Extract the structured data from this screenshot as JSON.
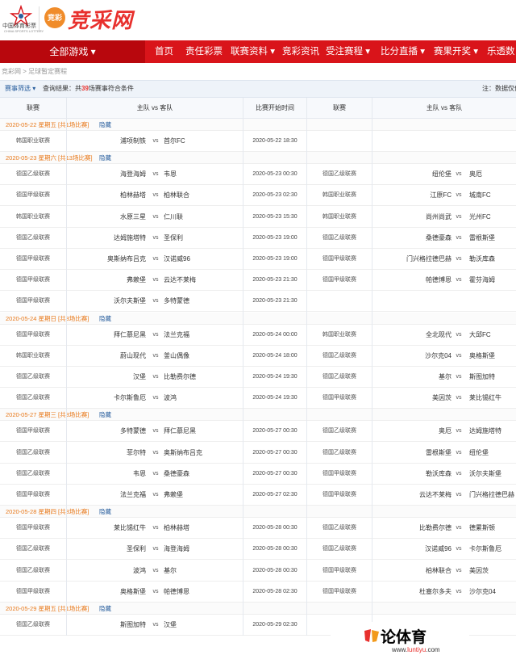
{
  "header": {
    "logo_cn": "中国体育彩票",
    "logo_en": "CHINA SPORTS LOTTERY",
    "badge": "竞彩",
    "site_name": "竞采网"
  },
  "nav": {
    "all_games": "全部游戏 ▾",
    "items": [
      "首页",
      "责任彩票",
      "联赛资料 ▾",
      "竞彩资讯",
      "受注赛程 ▾",
      "比分直播 ▾",
      "赛果开奖 ▾",
      "乐透数"
    ]
  },
  "breadcrumb": "竞彩网 > 足球暂定赛程",
  "filter": {
    "filter_label": "赛事筛选 ▾",
    "result_prefix": "查询结果：共",
    "result_count": "39",
    "result_suffix": "场赛事符合条件",
    "note": "注：数据仅供"
  },
  "table_header": {
    "league": "联赛",
    "teams": "主队 vs 客队",
    "time": "比赛开始时间",
    "league2": "联赛",
    "teams2": "主队 vs 客队"
  },
  "vs": "vs",
  "hide_label": "隐藏",
  "days": [
    {
      "date": "2020-05-22 星期五 [共1场比赛]",
      "rows": [
        {
          "l1": "韩国职业联赛",
          "h1": "浦项制铁",
          "a1": "首尔FC",
          "t1": "2020-05-22 18:30"
        }
      ]
    },
    {
      "date": "2020-05-23 星期六 [共13场比赛]",
      "rows": [
        {
          "l1": "德国乙级联赛",
          "h1": "海登海姆",
          "a1": "韦恩",
          "t1": "2020-05-23 00:30",
          "l2": "德国乙级联赛",
          "h2": "纽伦堡",
          "a2": "奥厄"
        },
        {
          "l1": "德国甲级联赛",
          "h1": "柏林赫塔",
          "a1": "柏林联合",
          "t1": "2020-05-23 02:30",
          "l2": "韩国职业联赛",
          "h2": "江原FC",
          "a2": "城南FC"
        },
        {
          "l1": "韩国职业联赛",
          "h1": "水原三星",
          "a1": "仁川联",
          "t1": "2020-05-23 15:30",
          "l2": "韩国职业联赛",
          "h2": "尚州尚武",
          "a2": "光州FC"
        },
        {
          "l1": "德国乙级联赛",
          "h1": "达姆施塔特",
          "a1": "圣保利",
          "t1": "2020-05-23 19:00",
          "l2": "德国乙级联赛",
          "h2": "桑德豪森",
          "a2": "雷根斯堡"
        },
        {
          "l1": "德国甲级联赛",
          "h1": "奥斯纳布吕克",
          "a1": "汉诺威96",
          "t1": "2020-05-23 19:00",
          "l2": "德国甲级联赛",
          "h2": "门兴格拉德巴赫",
          "a2": "勒沃库森"
        },
        {
          "l1": "德国甲级联赛",
          "h1": "弗赖堡",
          "a1": "云达不莱梅",
          "t1": "2020-05-23 21:30",
          "l2": "德国甲级联赛",
          "h2": "帕德博恩",
          "a2": "霍芬海姆"
        },
        {
          "l1": "德国甲级联赛",
          "h1": "沃尔夫斯堡",
          "a1": "多特蒙德",
          "t1": "2020-05-23 21:30"
        }
      ]
    },
    {
      "date": "2020-05-24 星期日 [共8场比赛]",
      "rows": [
        {
          "l1": "德国甲级联赛",
          "h1": "拜仁慕尼黑",
          "a1": "法兰克福",
          "t1": "2020-05-24 00:00",
          "l2": "韩国职业联赛",
          "h2": "全北现代",
          "a2": "大邱FC"
        },
        {
          "l1": "韩国职业联赛",
          "h1": "蔚山现代",
          "a1": "釜山偶像",
          "t1": "2020-05-24 18:00",
          "l2": "德国乙级联赛",
          "h2": "沙尔克04",
          "a2": "奥格斯堡"
        },
        {
          "l1": "德国乙级联赛",
          "h1": "汉堡",
          "a1": "比勒费尔德",
          "t1": "2020-05-24 19:30",
          "l2": "德国乙级联赛",
          "h2": "基尔",
          "a2": "斯图加特"
        },
        {
          "l1": "德国乙级联赛",
          "h1": "卡尔斯鲁厄",
          "a1": "波鸿",
          "t1": "2020-05-24 19:30",
          "l2": "德国甲级联赛",
          "h2": "美因茨",
          "a2": "莱比锡红牛"
        }
      ]
    },
    {
      "date": "2020-05-27 星期三 [共8场比赛]",
      "rows": [
        {
          "l1": "德国甲级联赛",
          "h1": "多特蒙德",
          "a1": "拜仁慕尼黑",
          "t1": "2020-05-27 00:30",
          "l2": "德国乙级联赛",
          "h2": "奥厄",
          "a2": "达姆施塔特"
        },
        {
          "l1": "德国乙级联赛",
          "h1": "菲尔特",
          "a1": "奥斯纳布吕克",
          "t1": "2020-05-27 00:30",
          "l2": "德国乙级联赛",
          "h2": "雷根斯堡",
          "a2": "纽伦堡"
        },
        {
          "l1": "德国乙级联赛",
          "h1": "韦恩",
          "a1": "桑德豪森",
          "t1": "2020-05-27 00:30",
          "l2": "德国甲级联赛",
          "h2": "勒沃库森",
          "a2": "沃尔夫斯堡"
        },
        {
          "l1": "德国甲级联赛",
          "h1": "法兰克福",
          "a1": "弗赖堡",
          "t1": "2020-05-27 02:30",
          "l2": "德国甲级联赛",
          "h2": "云达不莱梅",
          "a2": "门兴格拉德巴赫"
        }
      ]
    },
    {
      "date": "2020-05-28 星期四 [共8场比赛]",
      "rows": [
        {
          "l1": "德国甲级联赛",
          "h1": "莱比锡红牛",
          "a1": "柏林赫塔",
          "t1": "2020-05-28 00:30",
          "l2": "德国乙级联赛",
          "h2": "比勒费尔德",
          "a2": "德累斯顿"
        },
        {
          "l1": "德国乙级联赛",
          "h1": "圣保利",
          "a1": "海登海姆",
          "t1": "2020-05-28 00:30",
          "l2": "德国乙级联赛",
          "h2": "汉诺威96",
          "a2": "卡尔斯鲁厄"
        },
        {
          "l1": "德国乙级联赛",
          "h1": "波鸿",
          "a1": "基尔",
          "t1": "2020-05-28 00:30",
          "l2": "德国甲级联赛",
          "h2": "柏林联合",
          "a2": "美因茨"
        },
        {
          "l1": "德国甲级联赛",
          "h1": "奥格斯堡",
          "a1": "帕德博恩",
          "t1": "2020-05-28 02:30",
          "l2": "德国甲级联赛",
          "h2": "杜塞尔多夫",
          "a2": "沙尔克04"
        }
      ]
    },
    {
      "date": "2020-05-29 星期五 [共1场比赛]",
      "rows": [
        {
          "l1": "德国乙级联赛",
          "h1": "斯图加特",
          "a1": "汉堡",
          "t1": "2020-05-29 02:30"
        }
      ]
    }
  ],
  "watermark": {
    "main": "论体育",
    "url_prefix": "www.",
    "url_brand": "luntiyu",
    "url_suffix": ".com"
  }
}
